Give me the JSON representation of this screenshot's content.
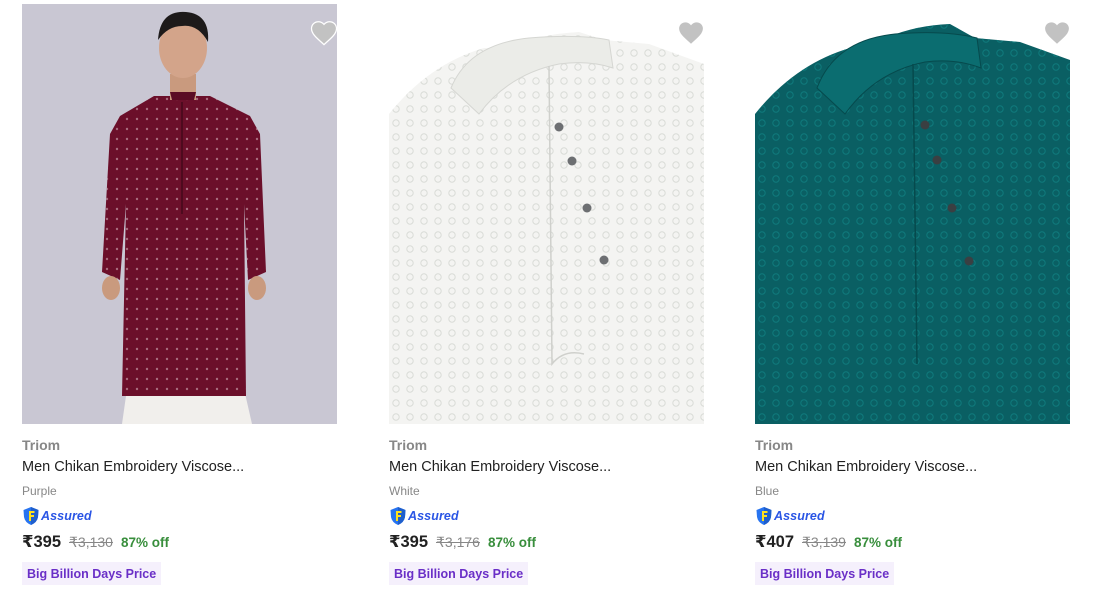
{
  "colors": {
    "price_off": "#388e3c",
    "assured_blue": "#2a55e5",
    "bbd_text": "#6a2fc7",
    "bbd_bg": "#f5f0fc",
    "wishlist_heart": "#c2c2c2"
  },
  "products": [
    {
      "brand": "Triom",
      "title": "Men Chikan Embroidery Viscose...",
      "color": "Purple",
      "assured_label": "Assured",
      "price": "₹395",
      "mrp": "₹3,130",
      "discount": "87% off",
      "tag": "Big Billion Days Price",
      "icon": "heart-icon"
    },
    {
      "brand": "Triom",
      "title": "Men Chikan Embroidery Viscose...",
      "color": "White",
      "assured_label": "Assured",
      "price": "₹395",
      "mrp": "₹3,176",
      "discount": "87% off",
      "tag": "Big Billion Days Price",
      "icon": "heart-icon"
    },
    {
      "brand": "Triom",
      "title": "Men Chikan Embroidery Viscose...",
      "color": "Blue",
      "assured_label": "Assured",
      "price": "₹407",
      "mrp": "₹3,139",
      "discount": "87% off",
      "tag": "Big Billion Days Price",
      "icon": "heart-icon"
    }
  ]
}
